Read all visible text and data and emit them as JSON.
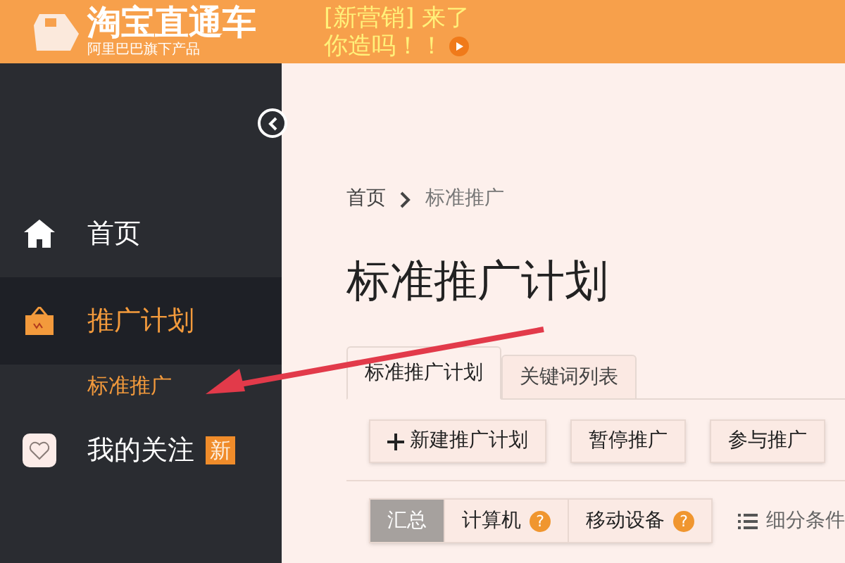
{
  "header": {
    "logo_text": "淘宝直通车",
    "logo_slogan": "阿里巴巴旗下产品",
    "promo_line_1": "[新营销] 来了",
    "promo_line_2": "你造吗！！"
  },
  "sidebar": {
    "items": [
      {
        "label": "首页",
        "kind": "home",
        "selected": false
      },
      {
        "label": "推广计划",
        "kind": "plan",
        "selected": true,
        "children": [
          {
            "label": "标准推广",
            "selected": true
          }
        ]
      },
      {
        "label": "我的关注",
        "kind": "follow",
        "selected": false,
        "badge": "新"
      }
    ]
  },
  "breadcrumb": [
    "首页",
    "标准推广"
  ],
  "page_title": "标准推广计划",
  "tabs": [
    {
      "label": "标准推广计划",
      "selected": true
    },
    {
      "label": "关键词列表",
      "selected": false
    }
  ],
  "toolbar": [
    {
      "label": "新建推广计划",
      "kind": "add"
    },
    {
      "label": "暂停推广",
      "kind": "plain"
    },
    {
      "label": "参与推广",
      "kind": "plain"
    }
  ],
  "segments": [
    {
      "label": "汇总",
      "selected": true
    },
    {
      "label": "计算机",
      "selected": false,
      "help": "?"
    },
    {
      "label": "移动设备",
      "selected": false,
      "help": "?"
    }
  ],
  "filter_link": "细分条件"
}
